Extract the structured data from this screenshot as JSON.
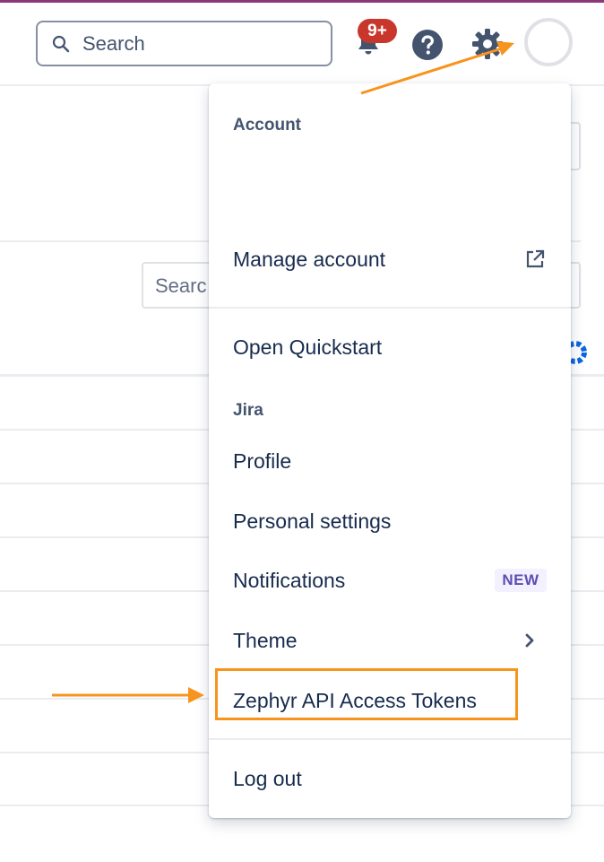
{
  "header": {
    "search_placeholder": "Search",
    "notification_badge": "9+",
    "icons": [
      "search-icon",
      "bell-icon",
      "help-icon",
      "gear-icon",
      "avatar"
    ]
  },
  "background": {
    "search_placeholder": "Searc"
  },
  "menu": {
    "account_heading": "Account",
    "manage_account": "Manage account",
    "open_quickstart": "Open Quickstart",
    "jira_heading": "Jira",
    "profile": "Profile",
    "personal_settings": "Personal settings",
    "notifications": "Notifications",
    "new_badge": "NEW",
    "theme": "Theme",
    "zephyr_tokens": "Zephyr API Access Tokens",
    "log_out": "Log out"
  },
  "colors": {
    "annotation": "#f7941d",
    "badge_red": "#c9372c",
    "text_primary": "#172b4d",
    "new_badge_text": "#5e4db2"
  }
}
